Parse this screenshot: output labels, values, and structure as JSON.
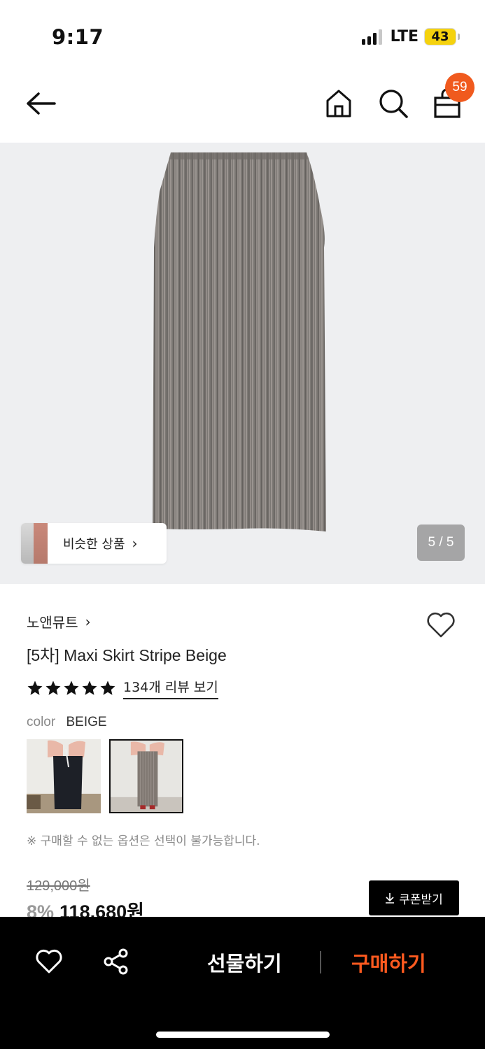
{
  "status": {
    "time": "9:17",
    "network": "LTE",
    "battery": "43"
  },
  "header": {
    "cart_count": "59"
  },
  "gallery": {
    "similar_label": "비슷한 상품",
    "chevron": "›",
    "page_indicator": "5 / 5"
  },
  "product": {
    "brand": "노앤뮤트",
    "brand_chevron": "›",
    "title": "[5차] Maxi Skirt Stripe Beige",
    "rating_stars": 5,
    "review_link": "134개 리뷰 보기",
    "color_label": "color",
    "color_value": "BEIGE",
    "swatches": [
      "black",
      "beige"
    ],
    "selected_swatch": "beige",
    "notice": "※ 구매할 수 없는 옵션은 선택이 불가능합니다.",
    "original_price": "129,000원",
    "discount": "8%",
    "final_price": "118,680원",
    "coupon_label": "쿠폰받기"
  },
  "bottom_bar": {
    "gift_label": "선물하기",
    "buy_label": "구매하기"
  },
  "colors": {
    "accent": "#ff5a1f",
    "badge": "#f05a1e",
    "battery": "#f5d20e"
  }
}
